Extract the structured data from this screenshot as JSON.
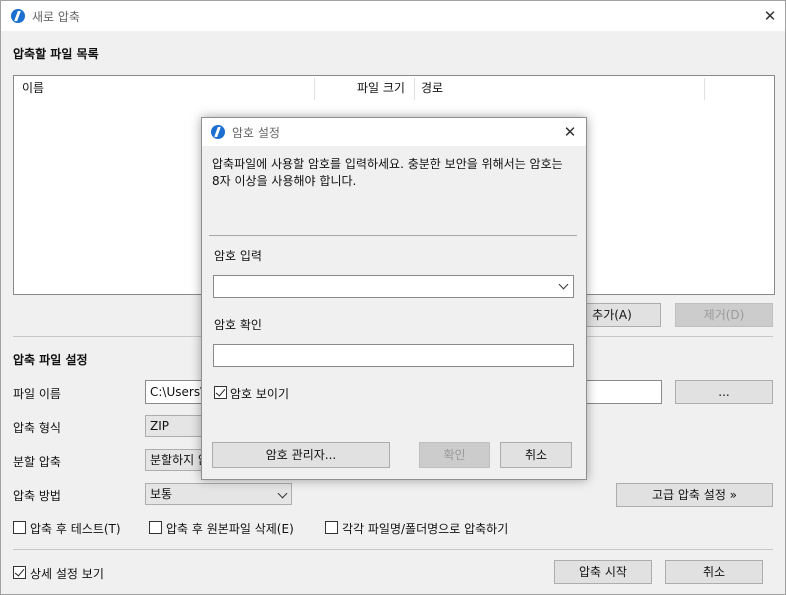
{
  "main": {
    "title": "새로 압축",
    "file_list_section": "압축할 파일 목록",
    "columns": [
      "이름",
      "파일 크기",
      "경로"
    ],
    "add_button": "추가(A)",
    "remove_button": "제거(D)",
    "settings_section": "압축 파일 설정",
    "filename_label": "파일 이름",
    "filename_value": "C:\\Users\\",
    "browse_button": "...",
    "format_label": "압축 형식",
    "format_value": "ZIP",
    "split_label": "분할 압축",
    "split_value": "분할하지 않",
    "method_label": "압축 방법",
    "method_value": "보통",
    "advanced_button": "고급 압축 설정 »",
    "test_after": "압축 후 테스트(T)",
    "delete_original": "압축 후 원본파일 삭제(E)",
    "each_file": "각각 파일명/폴더명으로 압축하기",
    "detail_view": "상세 설정 보기",
    "start_button": "압축 시작",
    "cancel_button": "취소"
  },
  "dialog": {
    "title": "암호 설정",
    "description": "압축파일에 사용할 암호를 입력하세요. 충분한 보안을 위해서는 암호는 8자 이상을 사용해야 합니다.",
    "password_label": "암호 입력",
    "confirm_label": "암호 확인",
    "show_password": "암호 보이기",
    "manager_button": "암호 관리자...",
    "ok_button": "확인",
    "cancel_button": "취소"
  },
  "colors": {
    "icon": "#1a6fd1",
    "disabled_text": "#9a9a9a"
  }
}
